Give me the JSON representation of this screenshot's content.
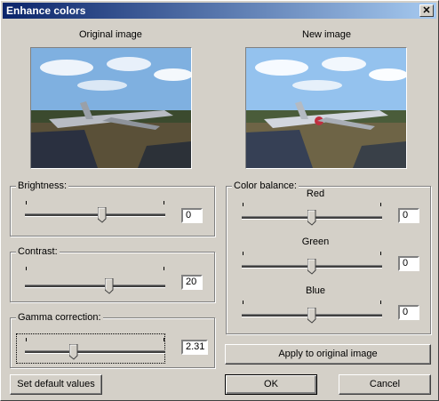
{
  "window": {
    "title": "Enhance colors",
    "close_symbol": "✕"
  },
  "previews": {
    "original_label": "Original image",
    "new_label": "New image"
  },
  "brightness": {
    "title": "Brightness:",
    "value": "0",
    "level": 0.55
  },
  "contrast": {
    "title": "Contrast:",
    "value": "20",
    "level": 0.6
  },
  "gamma": {
    "title": "Gamma correction:",
    "value": "2.31",
    "level": 0.35
  },
  "color_balance": {
    "title": "Color balance:",
    "red": {
      "label": "Red",
      "value": "0",
      "level": 0.5
    },
    "green": {
      "label": "Green",
      "value": "0",
      "level": 0.5
    },
    "blue": {
      "label": "Blue",
      "value": "0",
      "level": 0.5
    }
  },
  "buttons": {
    "apply": "Apply to original image",
    "defaults": "Set default values",
    "ok": "OK",
    "cancel": "Cancel"
  }
}
